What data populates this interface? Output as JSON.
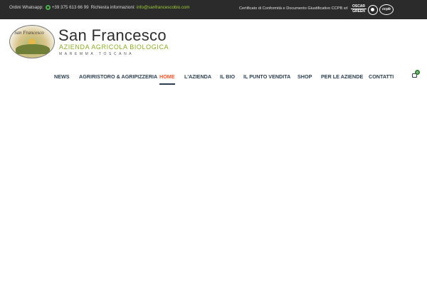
{
  "topbar": {
    "whatsapp_label": "Ordini Whatsapp:",
    "whatsapp_icon": "whatsapp-icon",
    "whatsapp_number": "+39 375 613 66 99",
    "info_label": "Richiesta informazioni:",
    "email": "info@sanfrancescobio.com",
    "certificate_text": "Certificato di Conformità e Documento Giustificativo CCPB srl",
    "oscar_top": "OSCAR",
    "oscar_bottom": "GREEN",
    "ccpb_label": "ccpb"
  },
  "brand": {
    "emblem_text": "San Francesco",
    "title": "San Francesco",
    "subtitle": "AZIENDA AGRICOLA BIOLOGICA",
    "location": "MAREMMA   TOSCANA"
  },
  "nav": {
    "items": [
      {
        "label": "NEWS"
      },
      {
        "label": "AGRIRISTORO & AGRIPIZZERIA"
      },
      {
        "label": "HOME"
      },
      {
        "label": "L'AZIENDA"
      },
      {
        "label": "IL BIO"
      },
      {
        "label": "IL PUNTO VENDITA"
      },
      {
        "label": "SHOP"
      },
      {
        "label": "PER LE AZIENDE"
      },
      {
        "label": "CONTATTI"
      }
    ],
    "active": "HOME",
    "cart_count": "0"
  },
  "colors": {
    "topbar_bg": "#2b2b2b",
    "accent_green": "#8aa92a",
    "active_nav": "#e0552a",
    "nav_text": "#2c3e50",
    "badge": "#2e7d32"
  }
}
